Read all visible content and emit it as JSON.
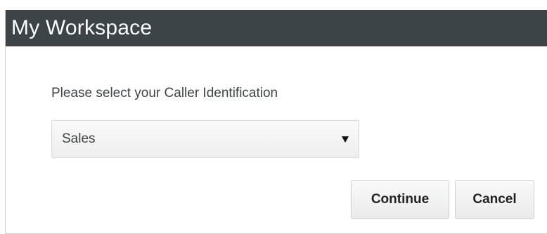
{
  "window": {
    "title": "My Workspace"
  },
  "form": {
    "prompt": "Please select your Caller Identification",
    "caller_id_select": {
      "selected": "Sales",
      "icon": "chevron-down-icon"
    }
  },
  "actions": {
    "continue_label": "Continue",
    "cancel_label": "Cancel"
  },
  "colors": {
    "titlebar_bg": "#3c4447",
    "titlebar_text": "#ffffff",
    "body_text": "#3f4548"
  }
}
